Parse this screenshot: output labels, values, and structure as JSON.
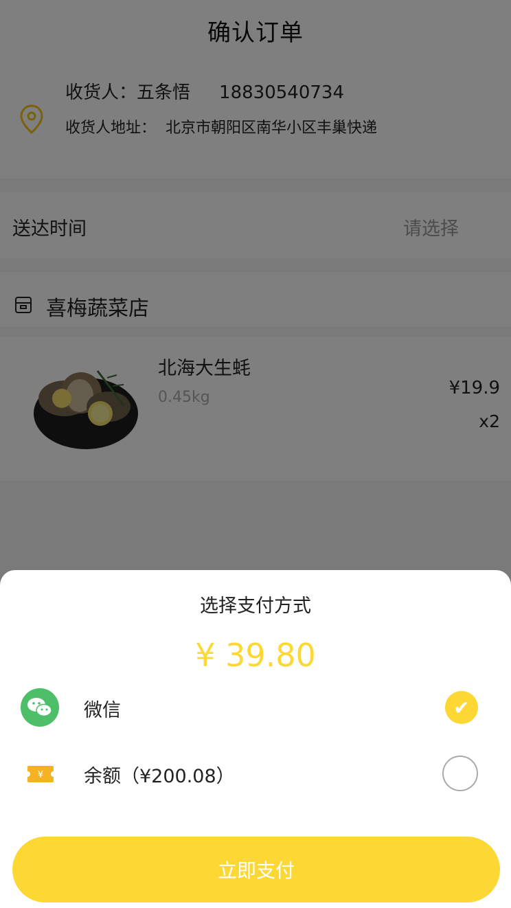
{
  "header": {
    "title": "确认订单"
  },
  "address": {
    "receiver_label": "收货人：",
    "receiver_name": "五条悟",
    "phone": "18830540734",
    "address_label": "收货人地址：",
    "address_value": "北京市朝阳区南华小区丰巢快递"
  },
  "delivery": {
    "label": "送达时间",
    "value": "请选择"
  },
  "shop": {
    "name": "喜梅蔬菜店"
  },
  "product": {
    "name": "北海大生蚝",
    "weight": "0.45kg",
    "price": "¥19.9",
    "quantity": "x2"
  },
  "payment_sheet": {
    "title": "选择支付方式",
    "amount": "¥ 39.80",
    "methods": [
      {
        "label": "微信",
        "icon": "wechat-icon",
        "selected": true
      },
      {
        "label": "余额（¥200.08）",
        "icon": "wallet-ticket-icon",
        "selected": false
      }
    ],
    "pay_button": "立即支付"
  },
  "colors": {
    "accent": "#fdd835",
    "wechat": "#4cbf68",
    "overlay": "rgba(0,0,0,0.5)"
  }
}
